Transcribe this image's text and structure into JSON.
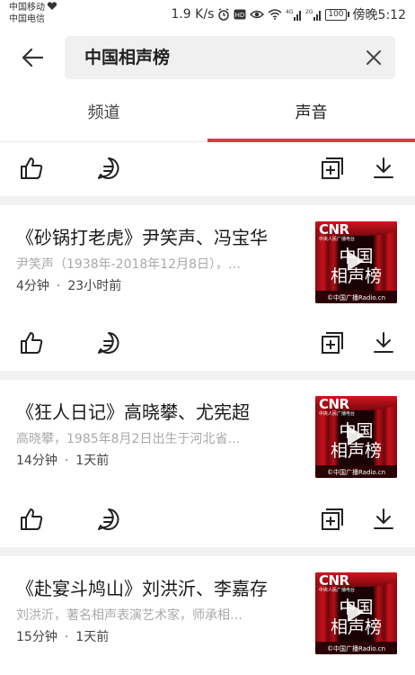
{
  "status_bar": {
    "carrier1": "中国移动",
    "carrier2": "中国电信",
    "speed": "1.9 K/s",
    "battery": "100",
    "time": "傍晚5:12"
  },
  "search": {
    "query": "中国相声榜"
  },
  "tabs": [
    {
      "label": "频道",
      "active": false
    },
    {
      "label": "声音",
      "active": true
    }
  ],
  "accent_color": "#e0374a",
  "thumbnail": {
    "brand": "CNR",
    "brand_sub": "中央人民广播电台",
    "line1": "中国",
    "line2": "相声榜",
    "footer": "©中国广播Radio.cn"
  },
  "items": [
    {
      "title": "《砂锅打老虎》尹笑声、冯宝华",
      "description": "尹笑声（1938年-2018年12月8日），…",
      "duration": "4分钟",
      "time": "23小时前"
    },
    {
      "title": "《狂人日记》高晓攀、尤宪超",
      "description": "高晓攀，1985年8月2日出生于河北省…",
      "duration": "14分钟",
      "time": "1天前"
    },
    {
      "title": "《赴宴斗鸠山》刘洪沂、李嘉存",
      "description": "刘洪沂，著名相声表演艺术家，师承相…",
      "duration": "15分钟",
      "time": "1天前"
    }
  ],
  "separator": "·",
  "icons": [
    "back-arrow-icon",
    "clear-x-icon",
    "thumbs-up-icon",
    "comment-icon",
    "add-to-playlist-icon",
    "download-icon"
  ]
}
